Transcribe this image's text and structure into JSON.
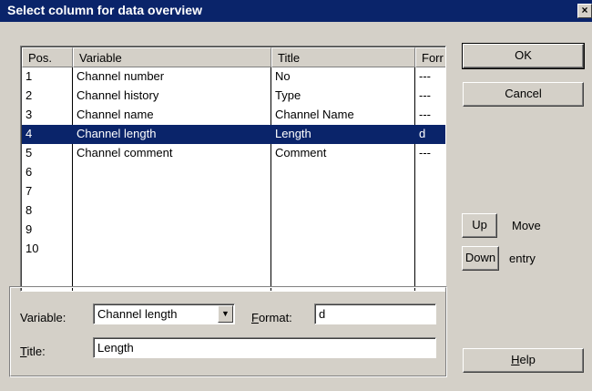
{
  "window": {
    "title": "Select column for data overview",
    "close_glyph": "×"
  },
  "list": {
    "columns": [
      "Pos.",
      "Variable",
      "Title",
      "Forr"
    ],
    "rows": [
      {
        "pos": "1",
        "variable": "Channel number",
        "title": "No",
        "format": "---"
      },
      {
        "pos": "2",
        "variable": "Channel history",
        "title": "Type",
        "format": "---"
      },
      {
        "pos": "3",
        "variable": "Channel name",
        "title": "Channel Name",
        "format": "---"
      },
      {
        "pos": "4",
        "variable": "Channel length",
        "title": "Length",
        "format": "d",
        "selected": true
      },
      {
        "pos": "5",
        "variable": "Channel comment",
        "title": "Comment",
        "format": "---"
      },
      {
        "pos": "6",
        "variable": "",
        "title": "",
        "format": ""
      },
      {
        "pos": "7",
        "variable": "",
        "title": "",
        "format": ""
      },
      {
        "pos": "8",
        "variable": "",
        "title": "",
        "format": ""
      },
      {
        "pos": "9",
        "variable": "",
        "title": "",
        "format": ""
      },
      {
        "pos": "10",
        "variable": "",
        "title": "",
        "format": ""
      }
    ]
  },
  "buttons": {
    "ok": "OK",
    "cancel": "Cancel",
    "up": "Up",
    "down": "Down",
    "move_label": "Move",
    "entry_label": "entry",
    "help_prefix": "",
    "help_accel": "H",
    "help_rest": "elp"
  },
  "form": {
    "variable_label": "Variable:",
    "variable_value": "Channel length",
    "format_accel": "F",
    "format_label_rest": "ormat:",
    "format_value": "d",
    "title_accel": "T",
    "title_label_rest": "itle:",
    "title_value": "Length"
  },
  "colors": {
    "selection": "#0a246a",
    "titlebar": "#0a246a",
    "face": "#d4d0c8"
  }
}
